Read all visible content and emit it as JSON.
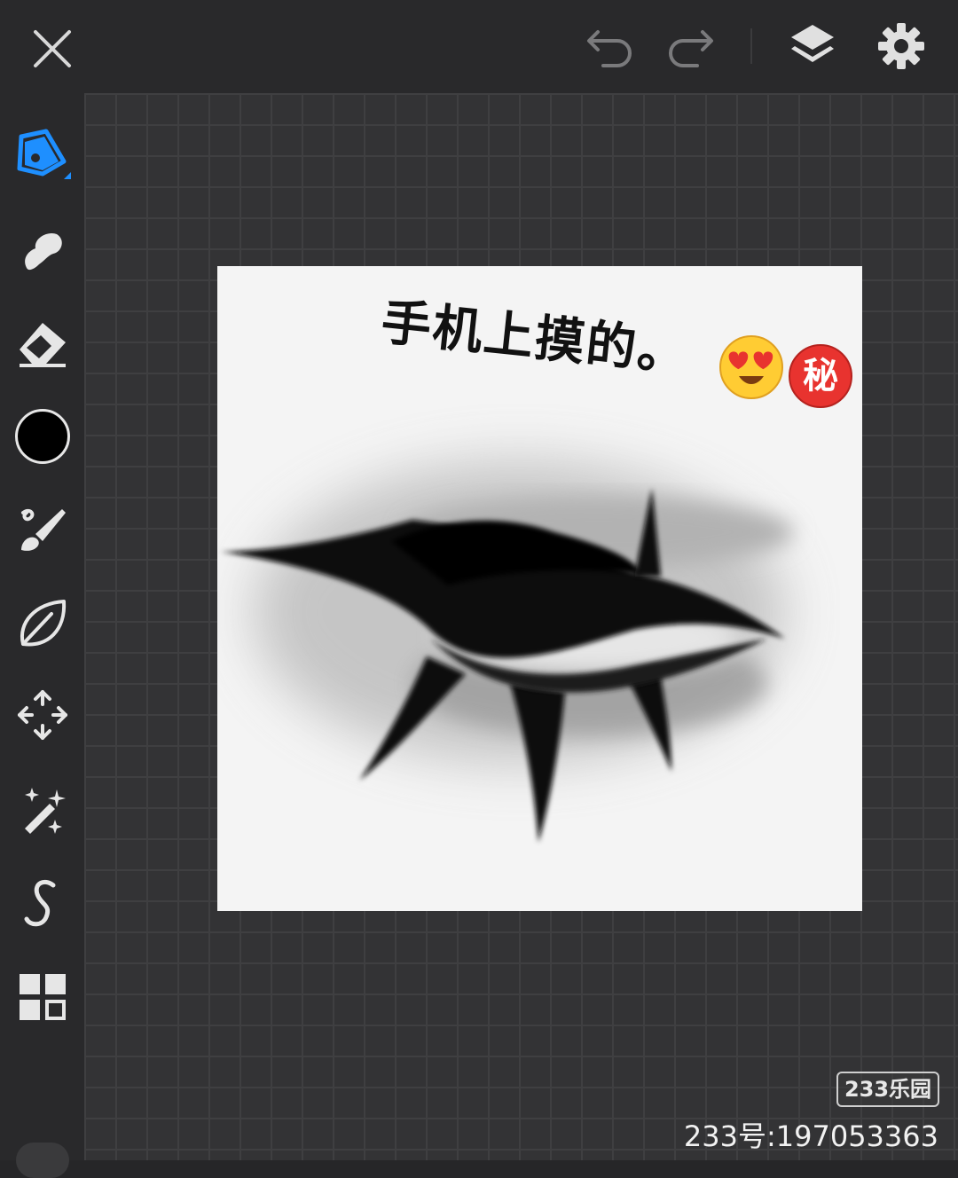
{
  "toolbar": {
    "close": "close-icon",
    "undo": "undo-icon",
    "redo": "redo-icon",
    "layers": "layers-icon",
    "settings": "gear-icon"
  },
  "sidebar": {
    "tools": [
      {
        "icon": "pencil-icon",
        "active": true
      },
      {
        "icon": "smudge-icon"
      },
      {
        "icon": "eraser-icon"
      },
      {
        "icon": "color-swatch",
        "color": "#000000"
      },
      {
        "icon": "brush-library-icon"
      },
      {
        "icon": "leaf-icon"
      },
      {
        "icon": "move-icon"
      },
      {
        "icon": "magic-wand-icon"
      },
      {
        "icon": "stroke-icon"
      },
      {
        "icon": "grid-icon"
      }
    ]
  },
  "colors": {
    "accent": "#1e8fff",
    "current_color": "#000000"
  },
  "canvas": {
    "caption": "手机上摸的。",
    "secret_emoji": "秘"
  },
  "watermark": {
    "logo": "233乐园",
    "id": "233号:197053363"
  }
}
